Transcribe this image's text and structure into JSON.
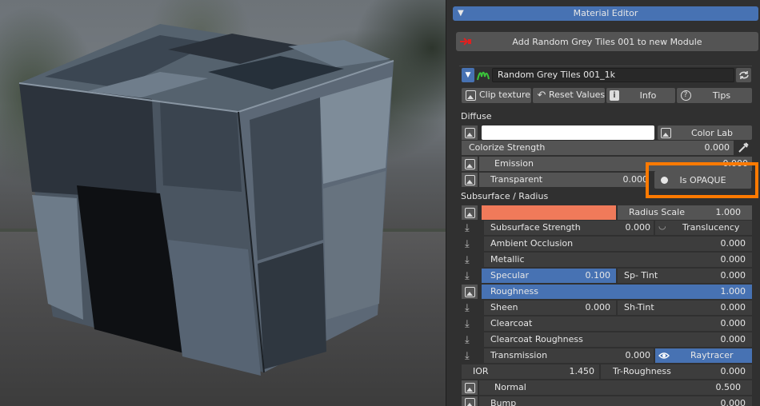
{
  "panel": {
    "title": "Material Editor",
    "add_button": "Add Random Grey Tiles 001 to new Module",
    "material_name": "Random Grey Tiles 001_1k",
    "toolbar": {
      "clip": "Clip texture",
      "reset": "Reset Values",
      "info": "Info",
      "tips": "Tips"
    }
  },
  "diffuse": {
    "label": "Diffuse",
    "color_lab": "Color Lab",
    "colorize_strength_label": "Colorize Strength",
    "colorize_strength_value": "0.000",
    "emission_label": "Emission",
    "emission_value": "0.000",
    "transparent_label": "Transparent",
    "transparent_value": "0.000",
    "opaque_label": "Is OPAQUE"
  },
  "subsurface": {
    "label": "Subsurface / Radius",
    "radius_scale_label": "Radius Scale",
    "radius_scale_value": "1.000",
    "color": "#f07a5a"
  },
  "rows": {
    "subsurface_strength": {
      "label": "Subsurface Strength",
      "value": "0.000"
    },
    "translucency": {
      "label": "Translucency"
    },
    "ambient_occlusion": {
      "label": "Ambient Occlusion",
      "value": "0.000"
    },
    "metallic": {
      "label": "Metallic",
      "value": "0.000"
    },
    "specular": {
      "label": "Specular",
      "value": "0.100"
    },
    "sp_tint": {
      "label": "Sp- Tint",
      "value": "0.000"
    },
    "roughness": {
      "label": "Roughness",
      "value": "1.000"
    },
    "sheen": {
      "label": "Sheen",
      "value": "0.000"
    },
    "sh_tint": {
      "label": "Sh-Tint",
      "value": "0.000"
    },
    "clearcoat": {
      "label": "Clearcoat",
      "value": "0.000"
    },
    "clearcoat_roughness": {
      "label": "Clearcoat Roughness",
      "value": "0.000"
    },
    "transmission": {
      "label": "Transmission",
      "value": "0.000"
    },
    "raytracer": {
      "label": "Raytracer"
    },
    "ior": {
      "label": "IOR",
      "value": "1.450"
    },
    "tr_roughness": {
      "label": "Tr-Roughness",
      "value": "0.000"
    },
    "normal": {
      "label": "Normal",
      "value": "0.500"
    },
    "bump": {
      "label": "Bump",
      "value": "0.000"
    }
  },
  "colors": {
    "accent": "#4772b3",
    "highlight": "#ff7a00",
    "subsurface": "#f07a5a"
  },
  "icons": [
    "disclosure-triangle-icon",
    "red-arrow-icon",
    "material-icon",
    "refresh-icon",
    "clip-icon",
    "reset-icon",
    "info-icon",
    "help-icon",
    "image-icon",
    "eyedropper-icon",
    "download-icon",
    "radio-icon",
    "curve-icon",
    "eye-icon"
  ]
}
